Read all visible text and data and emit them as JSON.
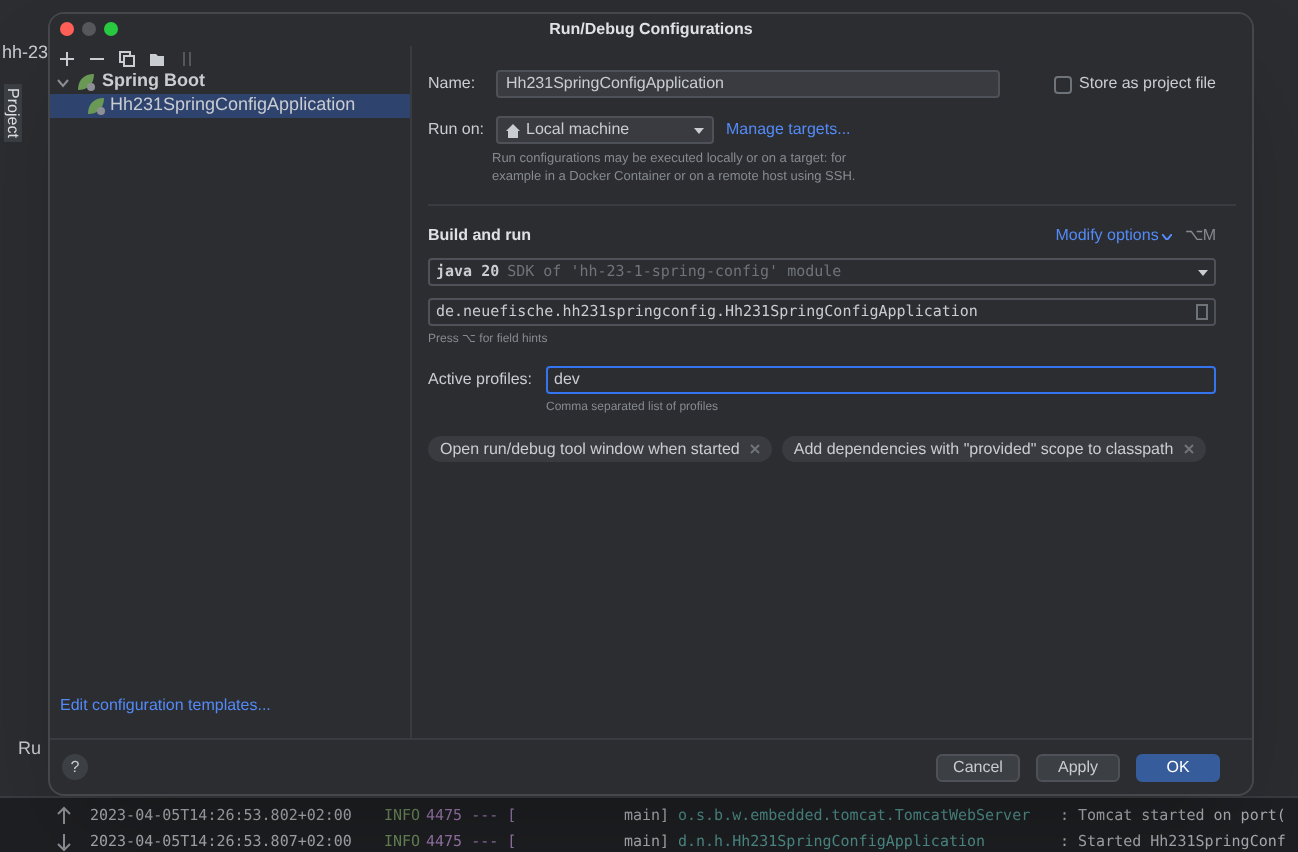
{
  "ide": {
    "project_label": "hh-23",
    "side_tab": "Project",
    "run_label": "Ru",
    "log": [
      {
        "time": "2023-04-05T14:26:53.802+02:00",
        "level": "INFO",
        "pid": "4475 --- [",
        "thread": "main]",
        "logger": "o.s.b.w.embedded.tomcat.TomcatWebServer",
        "message": ": Tomcat started on port("
      },
      {
        "time": "2023-04-05T14:26:53.807+02:00",
        "level": "INFO",
        "pid": "4475 --- [",
        "thread": "main]",
        "logger": "d.n.h.Hh231SpringConfigApplication",
        "message": ": Started Hh231SpringConf"
      }
    ]
  },
  "dialog": {
    "title": "Run/Debug Configurations",
    "tree": [
      {
        "label": "Spring Boot",
        "expanded": true,
        "selected": false,
        "children": [
          {
            "label": "Hh231SpringConfigApplication",
            "selected": true
          }
        ]
      }
    ],
    "edit_templates_link": "Edit configuration templates...",
    "name_label": "Name:",
    "name_value": "Hh231SpringConfigApplication",
    "store_label": "Store as project file",
    "store_checked": false,
    "run_on_label": "Run on:",
    "run_on_value": "Local machine",
    "manage_targets": "Manage targets...",
    "run_on_hint": "Run configurations may be executed locally or on a target: for example in a Docker Container or on a remote host using SSH.",
    "section_title": "Build and run",
    "modify_options": "Modify options",
    "modify_shortcut": "⌥M",
    "jdk_value": "java 20",
    "jdk_hint": "SDK of 'hh-23-1-spring-config' module",
    "main_class": "de.neuefische.hh231springconfig.Hh231SpringConfigApplication",
    "field_hints": "Press ⌥ for field hints",
    "profiles_label": "Active profiles:",
    "profiles_value": "dev",
    "profiles_hint": "Comma separated list of profiles",
    "chips": [
      "Open run/debug tool window when started",
      "Add dependencies with \"provided\" scope to classpath"
    ],
    "help": "?",
    "buttons": [
      {
        "label": "Cancel",
        "primary": false
      },
      {
        "label": "Apply",
        "primary": false
      },
      {
        "label": "OK",
        "primary": true
      }
    ]
  }
}
